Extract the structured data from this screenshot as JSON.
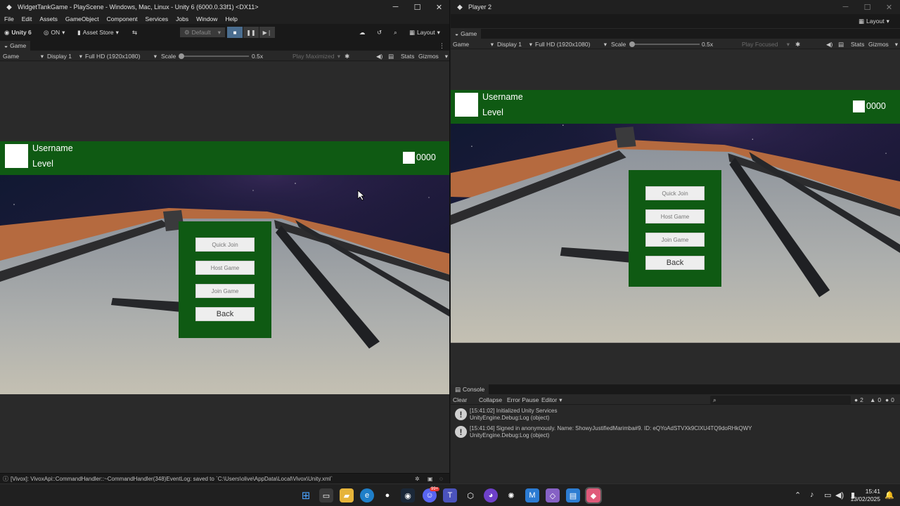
{
  "left_window": {
    "title": "WidgetTankGame - PlayScene - Windows, Mac, Linux - Unity 6 (6000.0.33f1) <DX11>",
    "menu": [
      "File",
      "Edit",
      "Assets",
      "GameObject",
      "Component",
      "Services",
      "Jobs",
      "Window",
      "Help"
    ],
    "toolbar": {
      "account": "Unity 6",
      "collab": "ON",
      "asset_store": "Asset Store",
      "layout_preset": "Default",
      "layout": "Layout"
    },
    "tab": "Game",
    "gamebar": {
      "view": "Game",
      "display": "Display 1",
      "resolution": "Full HD (1920x1080)",
      "scale_label": "Scale",
      "scale_value": "0.5x",
      "play_mode": "Play Maximized",
      "stats": "Stats",
      "gizmos": "Gizmos"
    },
    "status": "[Vivox]: VivoxApi::CommandHandler::~CommandHandler(348)EventLog: saved to `C:\\Users\\olive\\AppData\\Local\\Vivox\\Unity.xml`"
  },
  "right_window": {
    "title": "Player 2",
    "layout": "Layout",
    "tab": "Game",
    "gamebar": {
      "view": "Game",
      "display": "Display 1",
      "resolution": "Full HD (1920x1080)",
      "scale_label": "Scale",
      "scale_value": "0.5x",
      "play_mode": "Play Focused",
      "stats": "Stats",
      "gizmos": "Gizmos"
    },
    "console": {
      "tab": "Console",
      "buttons": [
        "Clear",
        "Collapse",
        "Error Pause",
        "Editor"
      ],
      "counts": {
        "info": "2",
        "warning": "0",
        "error": "0"
      },
      "logs": [
        {
          "line1": "[15:41:02] Initialized Unity Services",
          "line2": "UnityEngine.Debug:Log (object)"
        },
        {
          "line1": "[15:41:04] Signed in anonymously. Name: ShowyJustifiedMarimba#9. ID: eQYoAdSTVXk9ClXU4TQ9doRHkQWY",
          "line2": "UnityEngine.Debug:Log (object)"
        }
      ]
    }
  },
  "game_ui": {
    "username": "Username",
    "level": "Level",
    "coins": "0000",
    "buttons": {
      "quick_join": "Quick Join",
      "host_game": "Host Game",
      "join_game": "Join Game",
      "back": "Back"
    }
  },
  "taskbar": {
    "time": "15:41",
    "date": "13/02/2025",
    "badge": "99+"
  },
  "colors": {
    "hud_green": "#0f5a13",
    "editor_bg": "#282828",
    "play_active": "#4a6d8f"
  }
}
